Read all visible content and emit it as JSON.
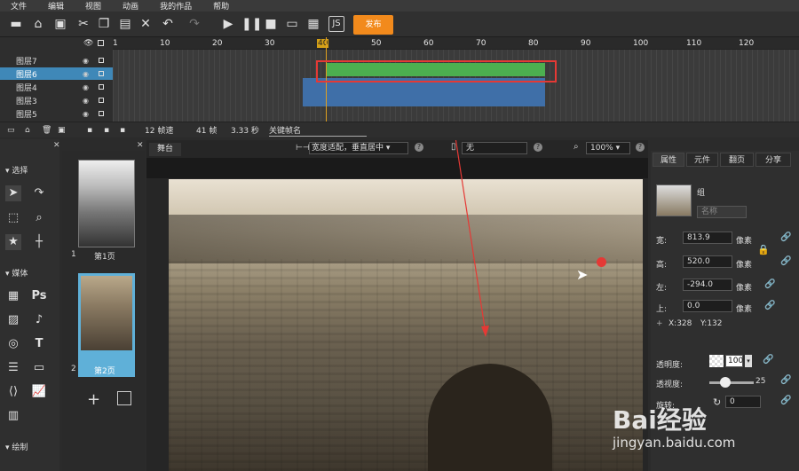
{
  "menu": [
    "文件",
    "编辑",
    "视图",
    "动画",
    "我的作品",
    "帮助"
  ],
  "toolbar": {
    "publish_label": "发布"
  },
  "layers": [
    {
      "name": "图层7",
      "selected": false
    },
    {
      "name": "图层6",
      "selected": true
    },
    {
      "name": "图层4",
      "selected": false
    },
    {
      "name": "图层3",
      "selected": false
    },
    {
      "name": "图层5",
      "selected": false
    }
  ],
  "ruler": [
    "1",
    "10",
    "20",
    "30",
    "40",
    "50",
    "60",
    "70",
    "80",
    "90",
    "100",
    "110",
    "120"
  ],
  "frameinfo": {
    "fps": "12 帧速",
    "frames": "41 帧",
    "seconds": "3.33 秒",
    "keyframe": "关键帧名"
  },
  "left": {
    "select_section": "选择",
    "media_section": "媒体",
    "draw_section": "绘制",
    "ps_label": "Ps"
  },
  "pages": [
    {
      "num": "1",
      "label": "第1页"
    },
    {
      "num": "2",
      "label": "第2页"
    }
  ],
  "stage": {
    "tab": "舞台",
    "fit_option": "宽度适配，垂直居中",
    "device_option": "无",
    "zoom": "100%"
  },
  "right": {
    "tabs": [
      "属性",
      "元件",
      "翻页",
      "分享"
    ],
    "object_type": "组",
    "name_placeholder": "名称",
    "width_label": "宽:",
    "width": "813.9",
    "height_label": "高:",
    "height": "520.0",
    "left_label": "左:",
    "left": "-294.0",
    "top_label": "上:",
    "top": "0.0",
    "unit": "像素",
    "coord_x": "X:328",
    "coord_y": "Y:132",
    "opacity_label": "透明度:",
    "opacity": "100",
    "blur_label": "透视度:",
    "blur": "25",
    "rotation_label": "旋转:",
    "rotation": "0"
  },
  "watermark": {
    "brand": "Bai经验",
    "url": "jingyan.baidu.com"
  },
  "colors": {
    "accent": "#f28a1c",
    "selection": "#3f88b8",
    "track_green": "#4caf50",
    "track_blue": "#3f6fa8",
    "highlight": "#e53935"
  }
}
